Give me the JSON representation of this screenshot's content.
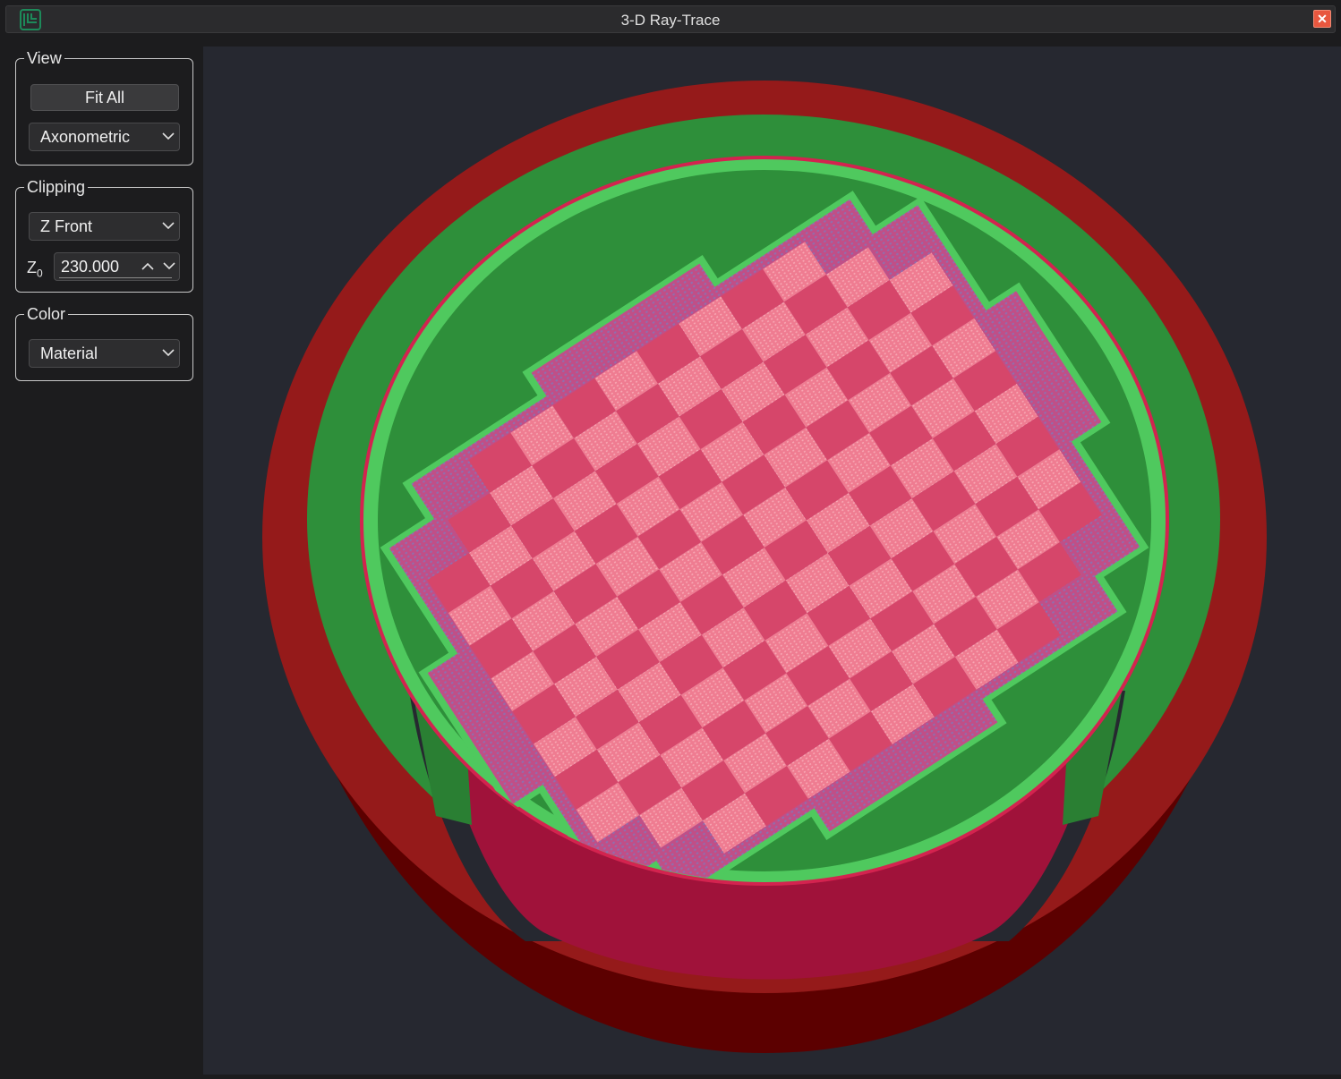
{
  "window": {
    "title": "3-D Ray-Trace"
  },
  "view": {
    "legend": "View",
    "fit_all_label": "Fit All",
    "projection": "Axonometric"
  },
  "clipping": {
    "legend": "Clipping",
    "plane": "Z Front",
    "z_label": "Z",
    "z_sub": "0",
    "z_value": "230.000"
  },
  "color": {
    "legend": "Color",
    "mode": "Material"
  },
  "colors": {
    "outer_ring": "#951a1a",
    "outer_ring_dark": "#5c0000",
    "green_wall": "#2e8f3a",
    "green_rim": "#4fc95e",
    "board_base": "#c04f87",
    "square_dark": "#d6466a",
    "square_light": "#ef7c91",
    "crimson_wall": "#a0123a"
  }
}
